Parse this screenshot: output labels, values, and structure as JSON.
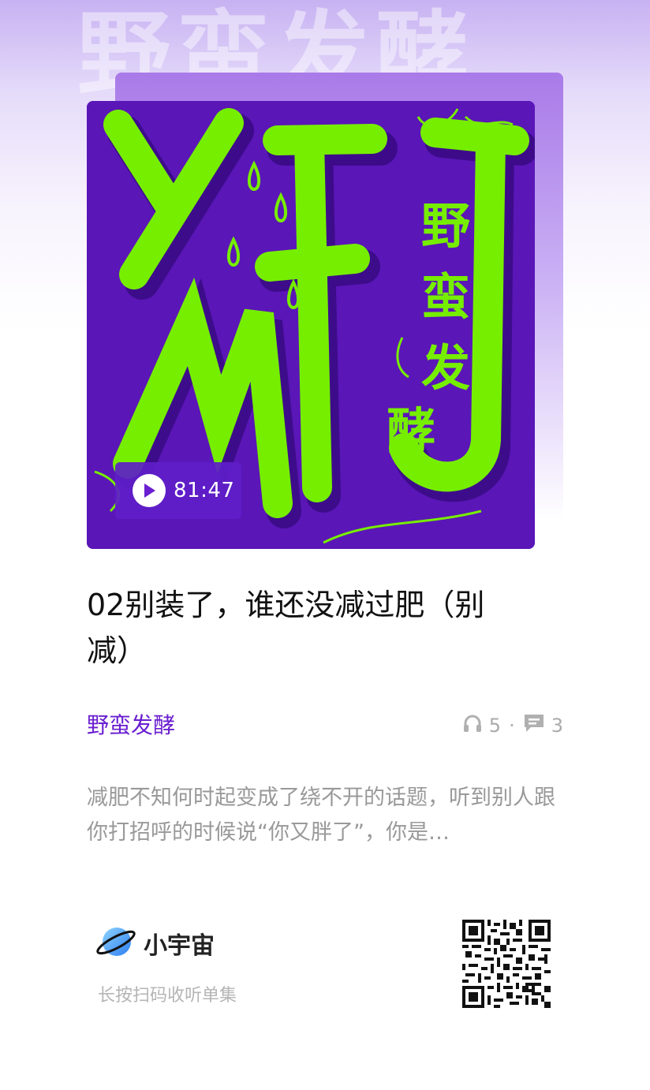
{
  "background_watermark": "野蛮发酵",
  "cover": {
    "art_text_large": "YMFJ",
    "art_text_vertical": "野蛮发酵",
    "duration": "81:47",
    "accent_color": "#76ee00",
    "bg_color": "#5a16b7"
  },
  "episode": {
    "title": "02别装了，谁还没减过肥（别减）"
  },
  "podcast": {
    "name": "野蛮发酵",
    "color": "#6a1fd0"
  },
  "stats": {
    "plays": "5",
    "separator": "·",
    "comments": "3"
  },
  "description": "减肥不知何时起变成了绕不开的话题，听到别人跟你打招呼的时候说“你又胖了”，你是…",
  "footer": {
    "brand_name": "小宇宙",
    "scan_tip": "长按扫码收听单集"
  },
  "icons": {
    "play": "play-icon",
    "headphones": "headphones-icon",
    "comment": "comment-icon",
    "logo": "planet-logo-icon",
    "qr": "qr-code"
  }
}
